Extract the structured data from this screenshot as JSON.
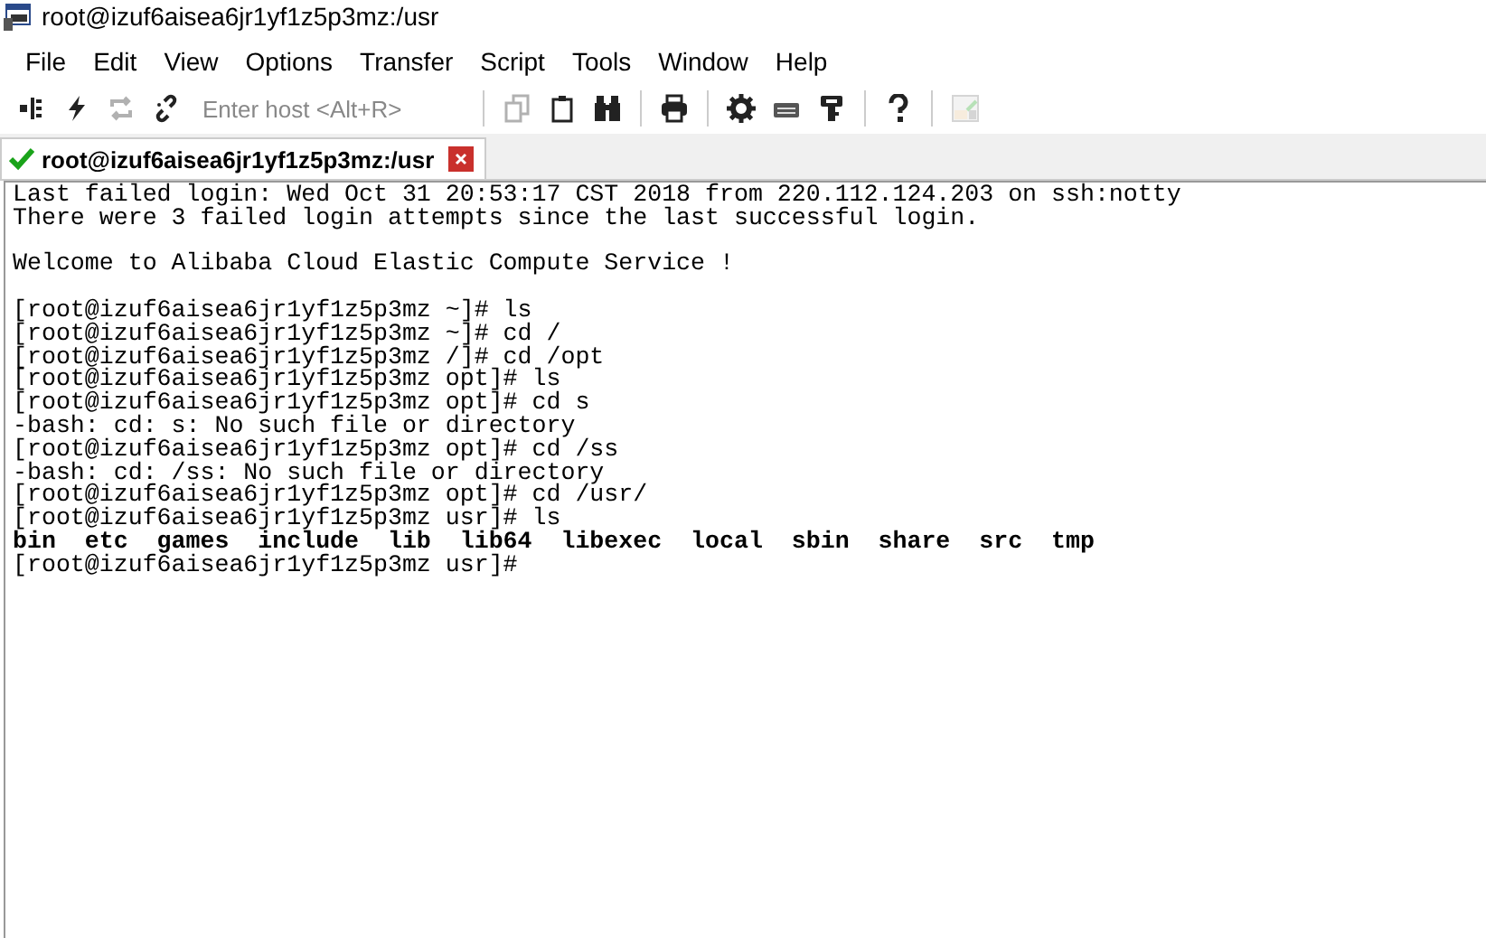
{
  "window": {
    "title": "root@izuf6aisea6jr1yf1z5p3mz:/usr"
  },
  "menu": [
    {
      "label": "File"
    },
    {
      "label": "Edit"
    },
    {
      "label": "View"
    },
    {
      "label": "Options"
    },
    {
      "label": "Transfer"
    },
    {
      "label": "Script"
    },
    {
      "label": "Tools"
    },
    {
      "label": "Window"
    },
    {
      "label": "Help"
    }
  ],
  "toolbar": {
    "buttons": [
      {
        "kind": "connect",
        "disabled": false
      },
      {
        "kind": "lightning",
        "disabled": false
      },
      {
        "kind": "reconnect",
        "disabled": true
      },
      {
        "kind": "link",
        "disabled": false
      },
      {
        "kind": "host-field",
        "placeholder": "Enter host <Alt+R>"
      },
      {
        "kind": "separator"
      },
      {
        "kind": "copy",
        "disabled": true
      },
      {
        "kind": "paste",
        "disabled": false
      },
      {
        "kind": "find",
        "disabled": false
      },
      {
        "kind": "separator"
      },
      {
        "kind": "print",
        "disabled": false
      },
      {
        "kind": "separator"
      },
      {
        "kind": "settings",
        "disabled": false
      },
      {
        "kind": "keyboard",
        "disabled": false
      },
      {
        "kind": "key",
        "disabled": false
      },
      {
        "kind": "separator"
      },
      {
        "kind": "help",
        "disabled": false
      },
      {
        "kind": "separator"
      },
      {
        "kind": "sftp",
        "disabled": true
      }
    ]
  },
  "tabs": [
    {
      "label": "root@izuf6aisea6jr1yf1z5p3mz:/usr",
      "selected": true,
      "connected": true
    }
  ],
  "terminal": {
    "lines": [
      {
        "kind": "output",
        "text": "Last failed login: Wed Oct 31 20:53:17 CST 2018 from 220.112.124.203 on ssh:notty"
      },
      {
        "kind": "output",
        "text": "There were 3 failed login attempts since the last successful login."
      },
      {
        "kind": "blank"
      },
      {
        "kind": "output",
        "text": "Welcome to Alibaba Cloud Elastic Compute Service !"
      },
      {
        "kind": "blank"
      },
      {
        "kind": "output",
        "text": "[root@izuf6aisea6jr1yf1z5p3mz ~]# ls"
      },
      {
        "kind": "output",
        "text": "[root@izuf6aisea6jr1yf1z5p3mz ~]# cd /"
      },
      {
        "kind": "output",
        "text": "[root@izuf6aisea6jr1yf1z5p3mz /]# cd /opt"
      },
      {
        "kind": "output",
        "text": "[root@izuf6aisea6jr1yf1z5p3mz opt]# ls"
      },
      {
        "kind": "output",
        "text": "[root@izuf6aisea6jr1yf1z5p3mz opt]# cd s"
      },
      {
        "kind": "output",
        "text": "-bash: cd: s: No such file or directory"
      },
      {
        "kind": "output",
        "text": "[root@izuf6aisea6jr1yf1z5p3mz opt]# cd /ss"
      },
      {
        "kind": "output",
        "text": "-bash: cd: /ss: No such file or directory"
      },
      {
        "kind": "output",
        "text": "[root@izuf6aisea6jr1yf1z5p3mz opt]# cd /usr/"
      },
      {
        "kind": "output",
        "text": "[root@izuf6aisea6jr1yf1z5p3mz usr]# ls"
      },
      {
        "kind": "listing",
        "text": "bin  etc  games  include  lib  lib64  libexec  local  sbin  share  src  tmp"
      },
      {
        "kind": "output",
        "text": "[root@izuf6aisea6jr1yf1z5p3mz usr]#"
      }
    ]
  }
}
